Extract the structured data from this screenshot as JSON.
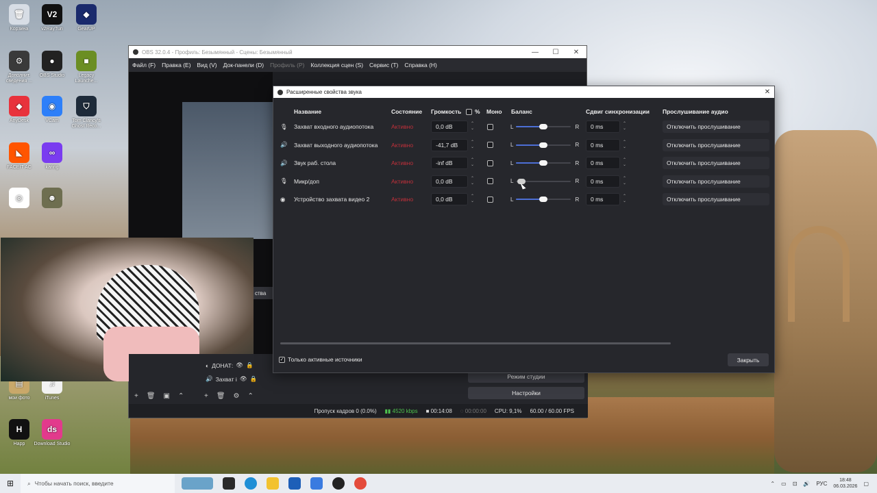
{
  "desktop": {
    "icons": [
      {
        "label": "Корзина",
        "color": "#d7dde5",
        "glyph": "🗑"
      },
      {
        "label": "v2RayTun",
        "color": "#111111",
        "glyph": "V2"
      },
      {
        "label": "GearUP",
        "color": "#1a2a6c",
        "glyph": "◆"
      },
      {
        "label": "Дополнит. сведения ...",
        "color": "#3a3a3a",
        "glyph": "⚙"
      },
      {
        "label": "OBS Studio",
        "color": "#222222",
        "glyph": "●"
      },
      {
        "label": "Legacy Launche...",
        "color": "#6b8e23",
        "glyph": "■"
      },
      {
        "label": "AnyDesk",
        "color": "#e8323c",
        "glyph": "◆"
      },
      {
        "label": "VCam",
        "color": "#2d7ff9",
        "glyph": "◉"
      },
      {
        "label": "Tom Clancy's Ghost Reco...",
        "color": "#1e2b3a",
        "glyph": "⛉"
      },
      {
        "label": "FACEIT AC",
        "color": "#ff5500",
        "glyph": "◣"
      },
      {
        "label": "karing",
        "color": "#7a3cf0",
        "glyph": "∞"
      },
      {
        "label": "",
        "color": "#ffffff",
        "glyph": "◎"
      },
      {
        "label": "",
        "color": "#6e6e50",
        "glyph": "☻"
      },
      {
        "label": "мои фото",
        "color": "#c9a86a",
        "glyph": "▤"
      },
      {
        "label": "iTunes",
        "color": "#f2f2f2",
        "glyph": "♫"
      },
      {
        "label": "Happ",
        "color": "#111111",
        "glyph": "H"
      },
      {
        "label": "Download Studio",
        "color": "#e23a8c",
        "glyph": "ds"
      }
    ]
  },
  "obs_main": {
    "title": "OBS 32.0.4 - Профиль: Безымянный - Сцены: Безымянный",
    "menu": [
      "Файл (F)",
      "Правка (E)",
      "Вид (V)",
      "Док-панели (D)",
      "Профиль (P)",
      "Коллекция сцен (S)",
      "Сервис (T)",
      "Справка (H)"
    ],
    "sources": [
      "ДОНАТ:",
      "Захват і"
    ],
    "properties_tab": "ства",
    "studio_mode": "Режим студии",
    "settings": "Настройки",
    "status": {
      "dropped": "Пропуск кадров 0 (0.0%)",
      "bitrate": "4520 kbps",
      "rec_time": "00:14:08",
      "stream_time": "00:00:00",
      "cpu": "CPU: 9,1%",
      "fps": "60.00 / 60.00 FPS"
    }
  },
  "dialog": {
    "title": "Расширенные свойства звука",
    "headers": {
      "name": "Название",
      "status": "Состояние",
      "volume": "Громкость",
      "percent": "%",
      "mono": "Моно",
      "balance": "Баланс",
      "sync": "Сдвиг синхронизации",
      "monitoring": "Прослушивание аудио"
    },
    "rows": [
      {
        "icon": "mic-icon",
        "glyph": "🎙",
        "name": "Захват входного аудиопотока",
        "status": "Активно",
        "volume": "0,0 dB",
        "balance": 0.5,
        "sync": "0 ms",
        "monitoring": "Отключить прослушивание"
      },
      {
        "icon": "speaker-icon",
        "glyph": "🔊",
        "name": "Захват выходного аудиопотока",
        "status": "Активно",
        "volume": "-41,7 dB",
        "balance": 0.5,
        "sync": "0 ms",
        "monitoring": "Отключить прослушивание"
      },
      {
        "icon": "speaker-icon",
        "glyph": "🔊",
        "name": "Звук раб. стола",
        "status": "Активно",
        "volume": "-inf dB",
        "balance": 0.5,
        "sync": "0 ms",
        "monitoring": "Отключить прослушивание"
      },
      {
        "icon": "mic-icon",
        "glyph": "🎙",
        "name": "Микр/доп",
        "status": "Активно",
        "volume": "0,0 dB",
        "balance": 0.0,
        "sync": "0 ms",
        "monitoring": "Отключить прослушивание"
      },
      {
        "icon": "camera-icon",
        "glyph": "◉",
        "name": "Устройство захвата видео 2",
        "status": "Активно",
        "volume": "0,0 dB",
        "balance": 0.5,
        "sync": "0 ms",
        "monitoring": "Отключить прослушивание"
      }
    ],
    "balance_left": "L",
    "balance_right": "R",
    "only_active": "Только активные источники",
    "close": "Закрыть"
  },
  "taskbar": {
    "search_placeholder": "Чтобы начать поиск, введите",
    "lang": "РУС",
    "time": "18:48",
    "date": "06.03.2026"
  }
}
